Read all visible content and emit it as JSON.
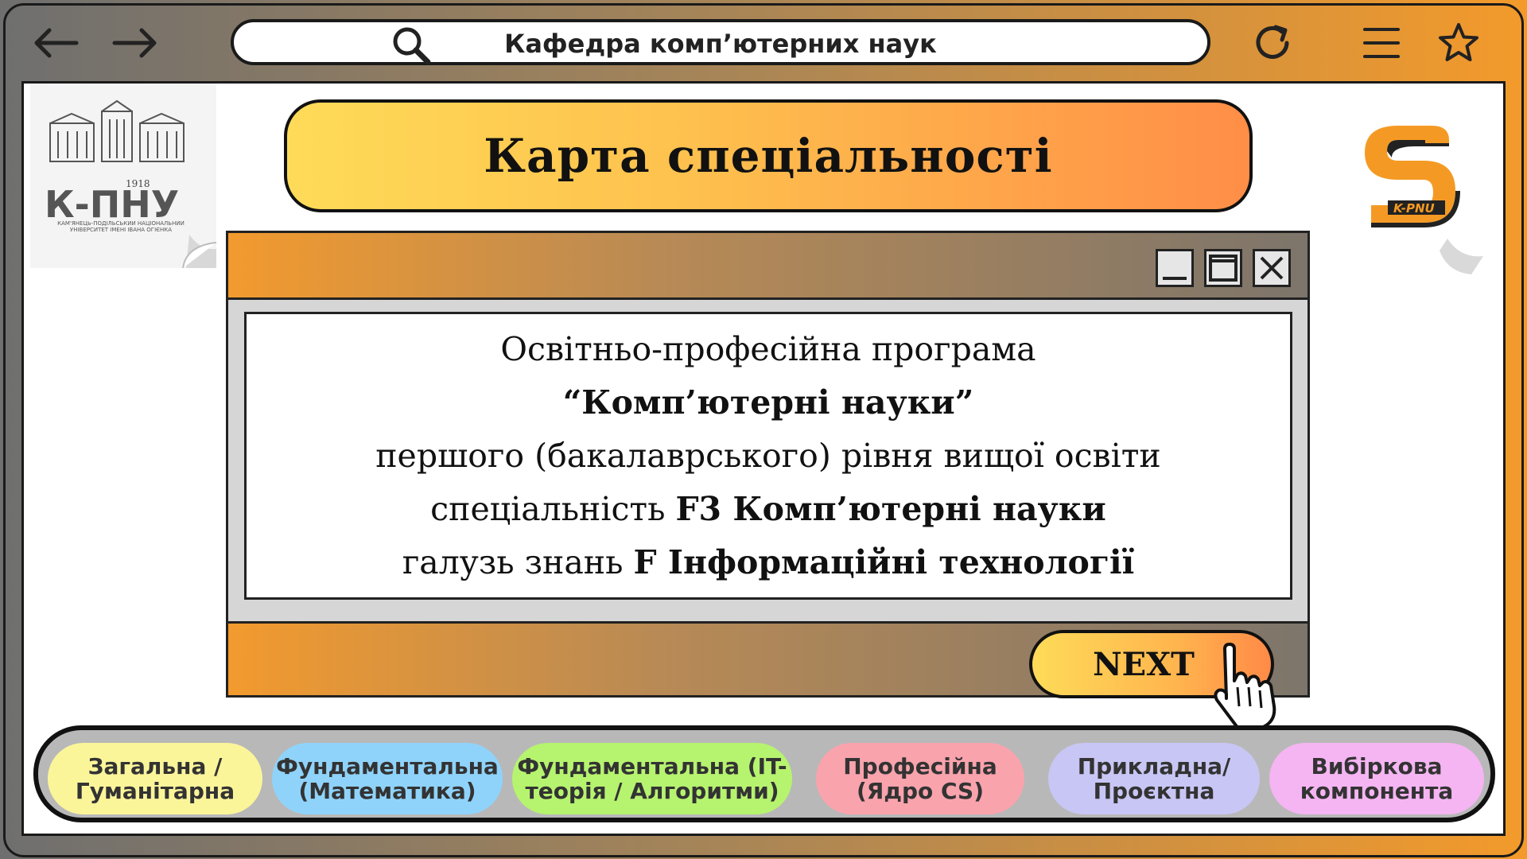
{
  "browser": {
    "url_text": "Кафедра комп’ютерних наук",
    "back_icon": "arrow-left-icon",
    "forward_icon": "arrow-right-icon",
    "search_icon": "search-icon",
    "reload_icon": "reload-icon",
    "menu_icon": "hamburger-menu-icon",
    "bookmark_icon": "star-icon"
  },
  "logos": {
    "left_text": "К-ПНУ",
    "left_year": "1918",
    "left_sub": "КАМ'ЯНЕЦЬ-ПОДІЛЬСЬКИЙ НАЦІОНАЛЬНИЙ УНІВЕРСИТЕТ ІМЕНІ ІВАНА ОГІЄНКА",
    "right_text": "K-PNU"
  },
  "title": "Карта спеціальності",
  "window": {
    "line1": "Освітньо-професійна програма",
    "line2": "“Комп’ютерні науки”",
    "line3": "першого (бакалаврського) рівня вищої освіти",
    "line4_prefix": "спеціальність ",
    "line4_bold": "F3 Комп’ютерні науки",
    "line5_prefix": "галузь знань ",
    "line5_bold": "F Інформаційні технології"
  },
  "next_label": "NEXT",
  "categories": [
    {
      "label": "Загальна /\nГуманітарна",
      "color": "#fbf59a"
    },
    {
      "label": "Фундаментальна\n(Математика)",
      "color": "#8fd3fb"
    },
    {
      "label": "Фундаментальна (IT-\nтеорія / Алгоритми)",
      "color": "#b6f36f"
    },
    {
      "label": "Професійна\n(Ядро CS)",
      "color": "#f9a3ad"
    },
    {
      "label": "Прикладна/\nПроєктна",
      "color": "#c8c6f4"
    },
    {
      "label": "Вибіркова\nкомпонента",
      "color": "#f4b5f2"
    }
  ],
  "colors": {
    "accent_orange": "#f39a2b",
    "title_gradient_start": "#fedb58",
    "title_gradient_end": "#ff8e47"
  }
}
